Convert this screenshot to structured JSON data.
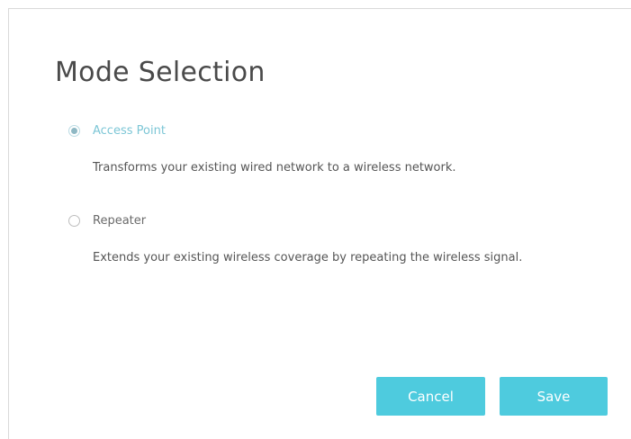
{
  "dialog": {
    "title": "Mode Selection",
    "options": [
      {
        "label": "Access Point",
        "selected": true,
        "description": "Transforms your existing wired network to a wireless network."
      },
      {
        "label": "Repeater",
        "selected": false,
        "description": "Extends your existing wireless coverage by repeating the wireless signal."
      }
    ],
    "buttons": {
      "cancel_label": "Cancel",
      "save_label": "Save"
    },
    "colors": {
      "accent": "#4ecbde",
      "selected_label": "#7cc6d6"
    }
  }
}
